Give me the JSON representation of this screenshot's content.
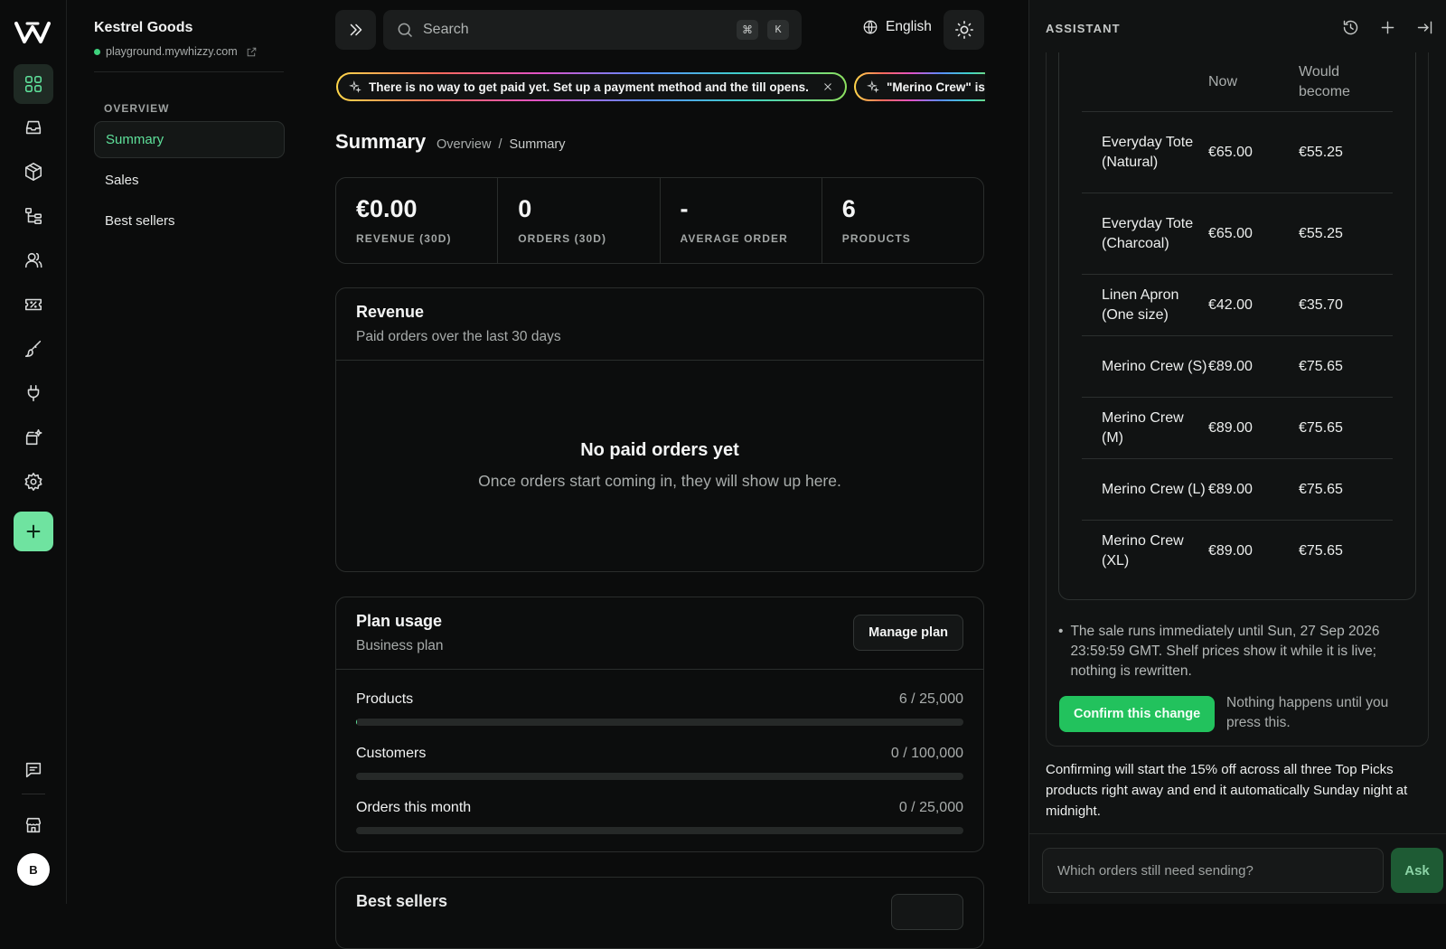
{
  "brand": {
    "logo": "w-logo"
  },
  "rail": {
    "items": [
      "grid-icon",
      "inbox-icon",
      "box-icon",
      "tree-icon",
      "users-icon",
      "ticket-icon",
      "brush-icon",
      "plug-icon",
      "sparkle-box-icon",
      "gear-icon",
      "plus-icon"
    ],
    "bottom": [
      "chat-icon",
      "store-icon"
    ],
    "avatar": "B"
  },
  "store": {
    "name": "Kestrel Goods",
    "url": "playground.mywhizzy.com"
  },
  "subnav": {
    "section": "OVERVIEW",
    "items": [
      {
        "label": "Summary",
        "active": true
      },
      {
        "label": "Sales"
      },
      {
        "label": "Best sellers"
      }
    ]
  },
  "search": {
    "placeholder": "Search",
    "kbd1": "⌘",
    "kbd2": "K"
  },
  "language": "English",
  "banners": [
    {
      "text": "There is no way to get paid yet. Set up a payment method and the till opens."
    },
    {
      "text": "\"Merino Crew\" is"
    }
  ],
  "page": {
    "title": "Summary",
    "breadcrumb": [
      "Overview",
      "Summary"
    ]
  },
  "stats": [
    {
      "value": "€0.00",
      "label": "REVENUE (30D)"
    },
    {
      "value": "0",
      "label": "ORDERS (30D)"
    },
    {
      "value": "-",
      "label": "AVERAGE ORDER"
    },
    {
      "value": "6",
      "label": "PRODUCTS"
    }
  ],
  "revenue": {
    "title": "Revenue",
    "subtitle": "Paid orders over the last 30 days",
    "empty_title": "No paid orders yet",
    "empty_desc": "Once orders start coming in, they will show up here."
  },
  "plan": {
    "title": "Plan usage",
    "subtitle": "Business plan",
    "manage_label": "Manage plan",
    "usage": [
      {
        "name": "Products",
        "count": "6 / 25,000",
        "fraction": 0.00024
      },
      {
        "name": "Customers",
        "count": "0 / 100,000",
        "fraction": 0
      },
      {
        "name": "Orders this month",
        "count": "0 / 25,000",
        "fraction": 0
      }
    ]
  },
  "best_sellers": {
    "title": "Best sellers"
  },
  "assistant": {
    "title": "ASSISTANT",
    "icons": [
      "history-icon",
      "new-chat-icon",
      "collapse-panel-icon"
    ],
    "table": {
      "headers": [
        "",
        "Now",
        "Would become"
      ],
      "rows": [
        [
          "Everyday Tote (Natural)",
          "€65.00",
          "€55.25"
        ],
        [
          "Everyday Tote (Charcoal)",
          "€65.00",
          "€55.25"
        ],
        [
          "Linen Apron (One size)",
          "€42.00",
          "€35.70"
        ],
        [
          "Merino Crew (S)",
          "€89.00",
          "€75.65"
        ],
        [
          "Merino Crew (M)",
          "€89.00",
          "€75.65"
        ],
        [
          "Merino Crew (L)",
          "€89.00",
          "€75.65"
        ],
        [
          "Merino Crew (XL)",
          "€89.00",
          "€75.65"
        ]
      ]
    },
    "note": "The sale runs immediately until Sun, 27 Sep 2026 23:59:59 GMT. Shelf prices show it while it is live; nothing is rewritten.",
    "confirm_label": "Confirm this change",
    "confirm_hint": "Nothing happens until you press this.",
    "reply": "Confirming will start the 15% off across all three Top Picks products right away and end it automatically Sunday night at midnight.",
    "composer_placeholder": "Which orders still need sending?",
    "ask_label": "Ask"
  },
  "colors": {
    "accent": "#5ee09a",
    "confirm": "#22c25d",
    "background": "#0b0c0c"
  }
}
